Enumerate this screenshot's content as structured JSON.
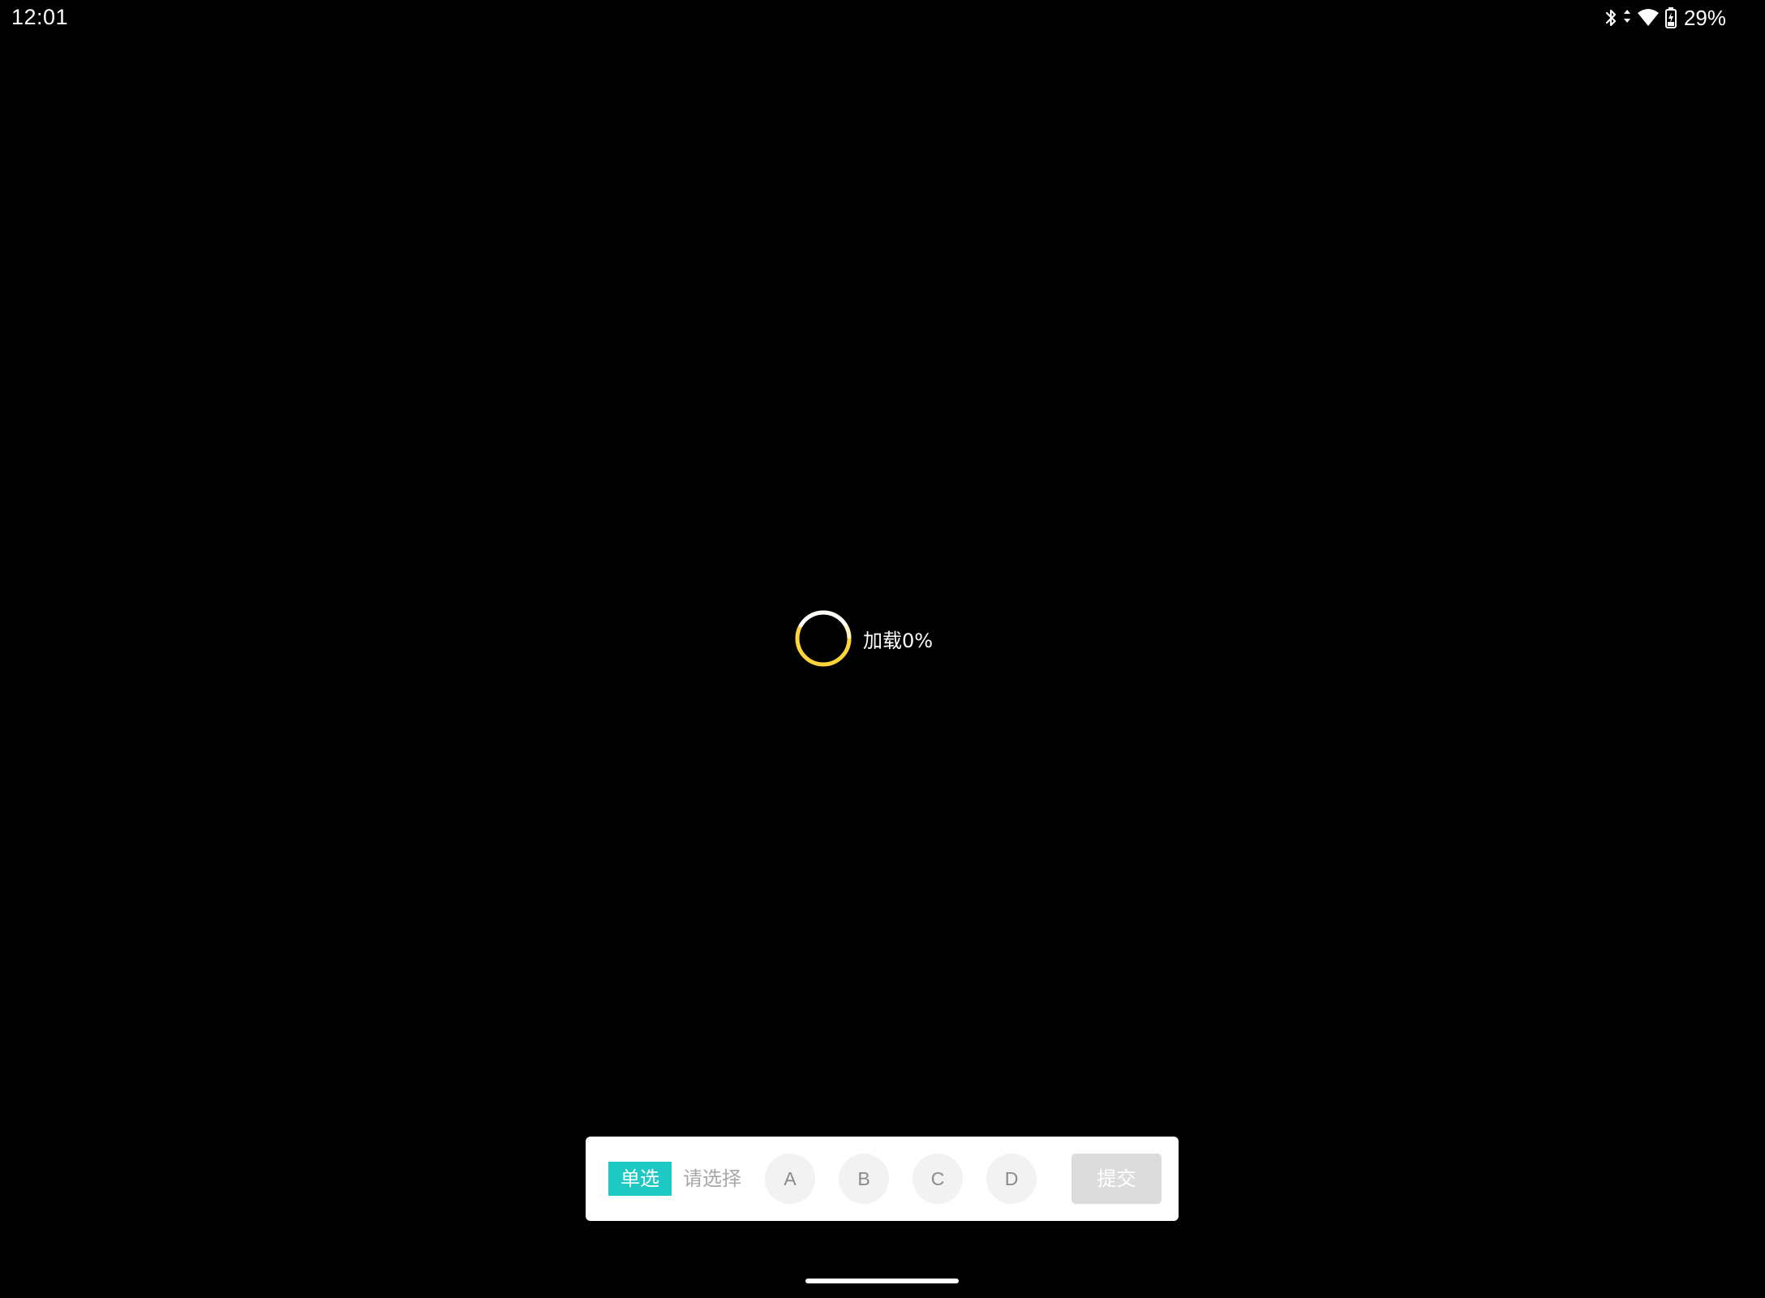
{
  "status_bar": {
    "time": "12:01",
    "battery_percent": "29%",
    "icons": [
      "bluetooth-icon",
      "data-activity-icon",
      "wifi-icon",
      "battery-charging-icon"
    ]
  },
  "loader": {
    "text": "加载0%",
    "progress": 0,
    "ring_color": "#ffd43b",
    "ring_highlight": "#ffffff"
  },
  "answer_card": {
    "type_label": "单选",
    "prompt": "请选择",
    "options": [
      "A",
      "B",
      "C",
      "D"
    ],
    "submit_label": "提交",
    "accent_color": "#1ec8c3"
  }
}
